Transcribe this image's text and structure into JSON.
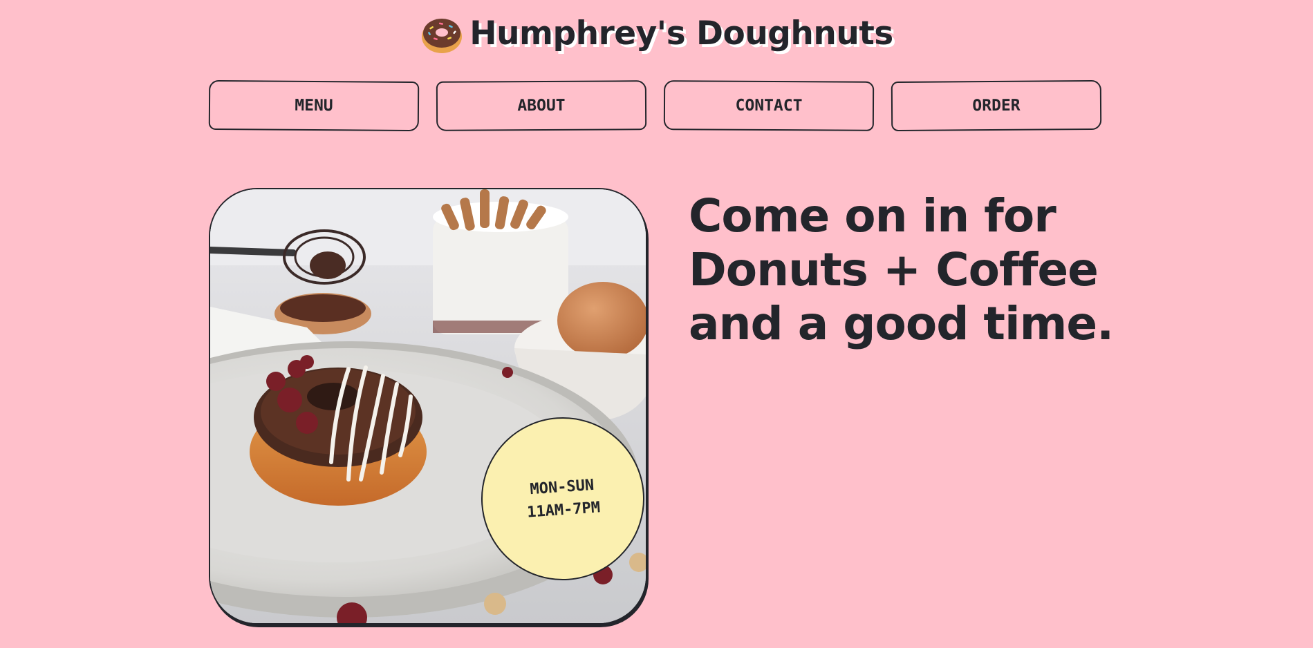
{
  "header": {
    "logo_icon": "doughnut-icon",
    "title": "Humphrey's Doughnuts"
  },
  "nav": {
    "items": [
      {
        "label": "MENU"
      },
      {
        "label": "ABOUT"
      },
      {
        "label": "CONTACT"
      },
      {
        "label": "ORDER"
      }
    ]
  },
  "hero": {
    "image": "chocolate-doughnut-photo",
    "hours": {
      "days": "MON-SUN",
      "time": "11AM-7PM"
    },
    "headline": "Come on in for Donuts + Coffee and a good time."
  },
  "colors": {
    "background": "#ffc0cb",
    "text": "#23252b",
    "badge": "#fbf0b0",
    "title_shadow": "#ffffff"
  }
}
